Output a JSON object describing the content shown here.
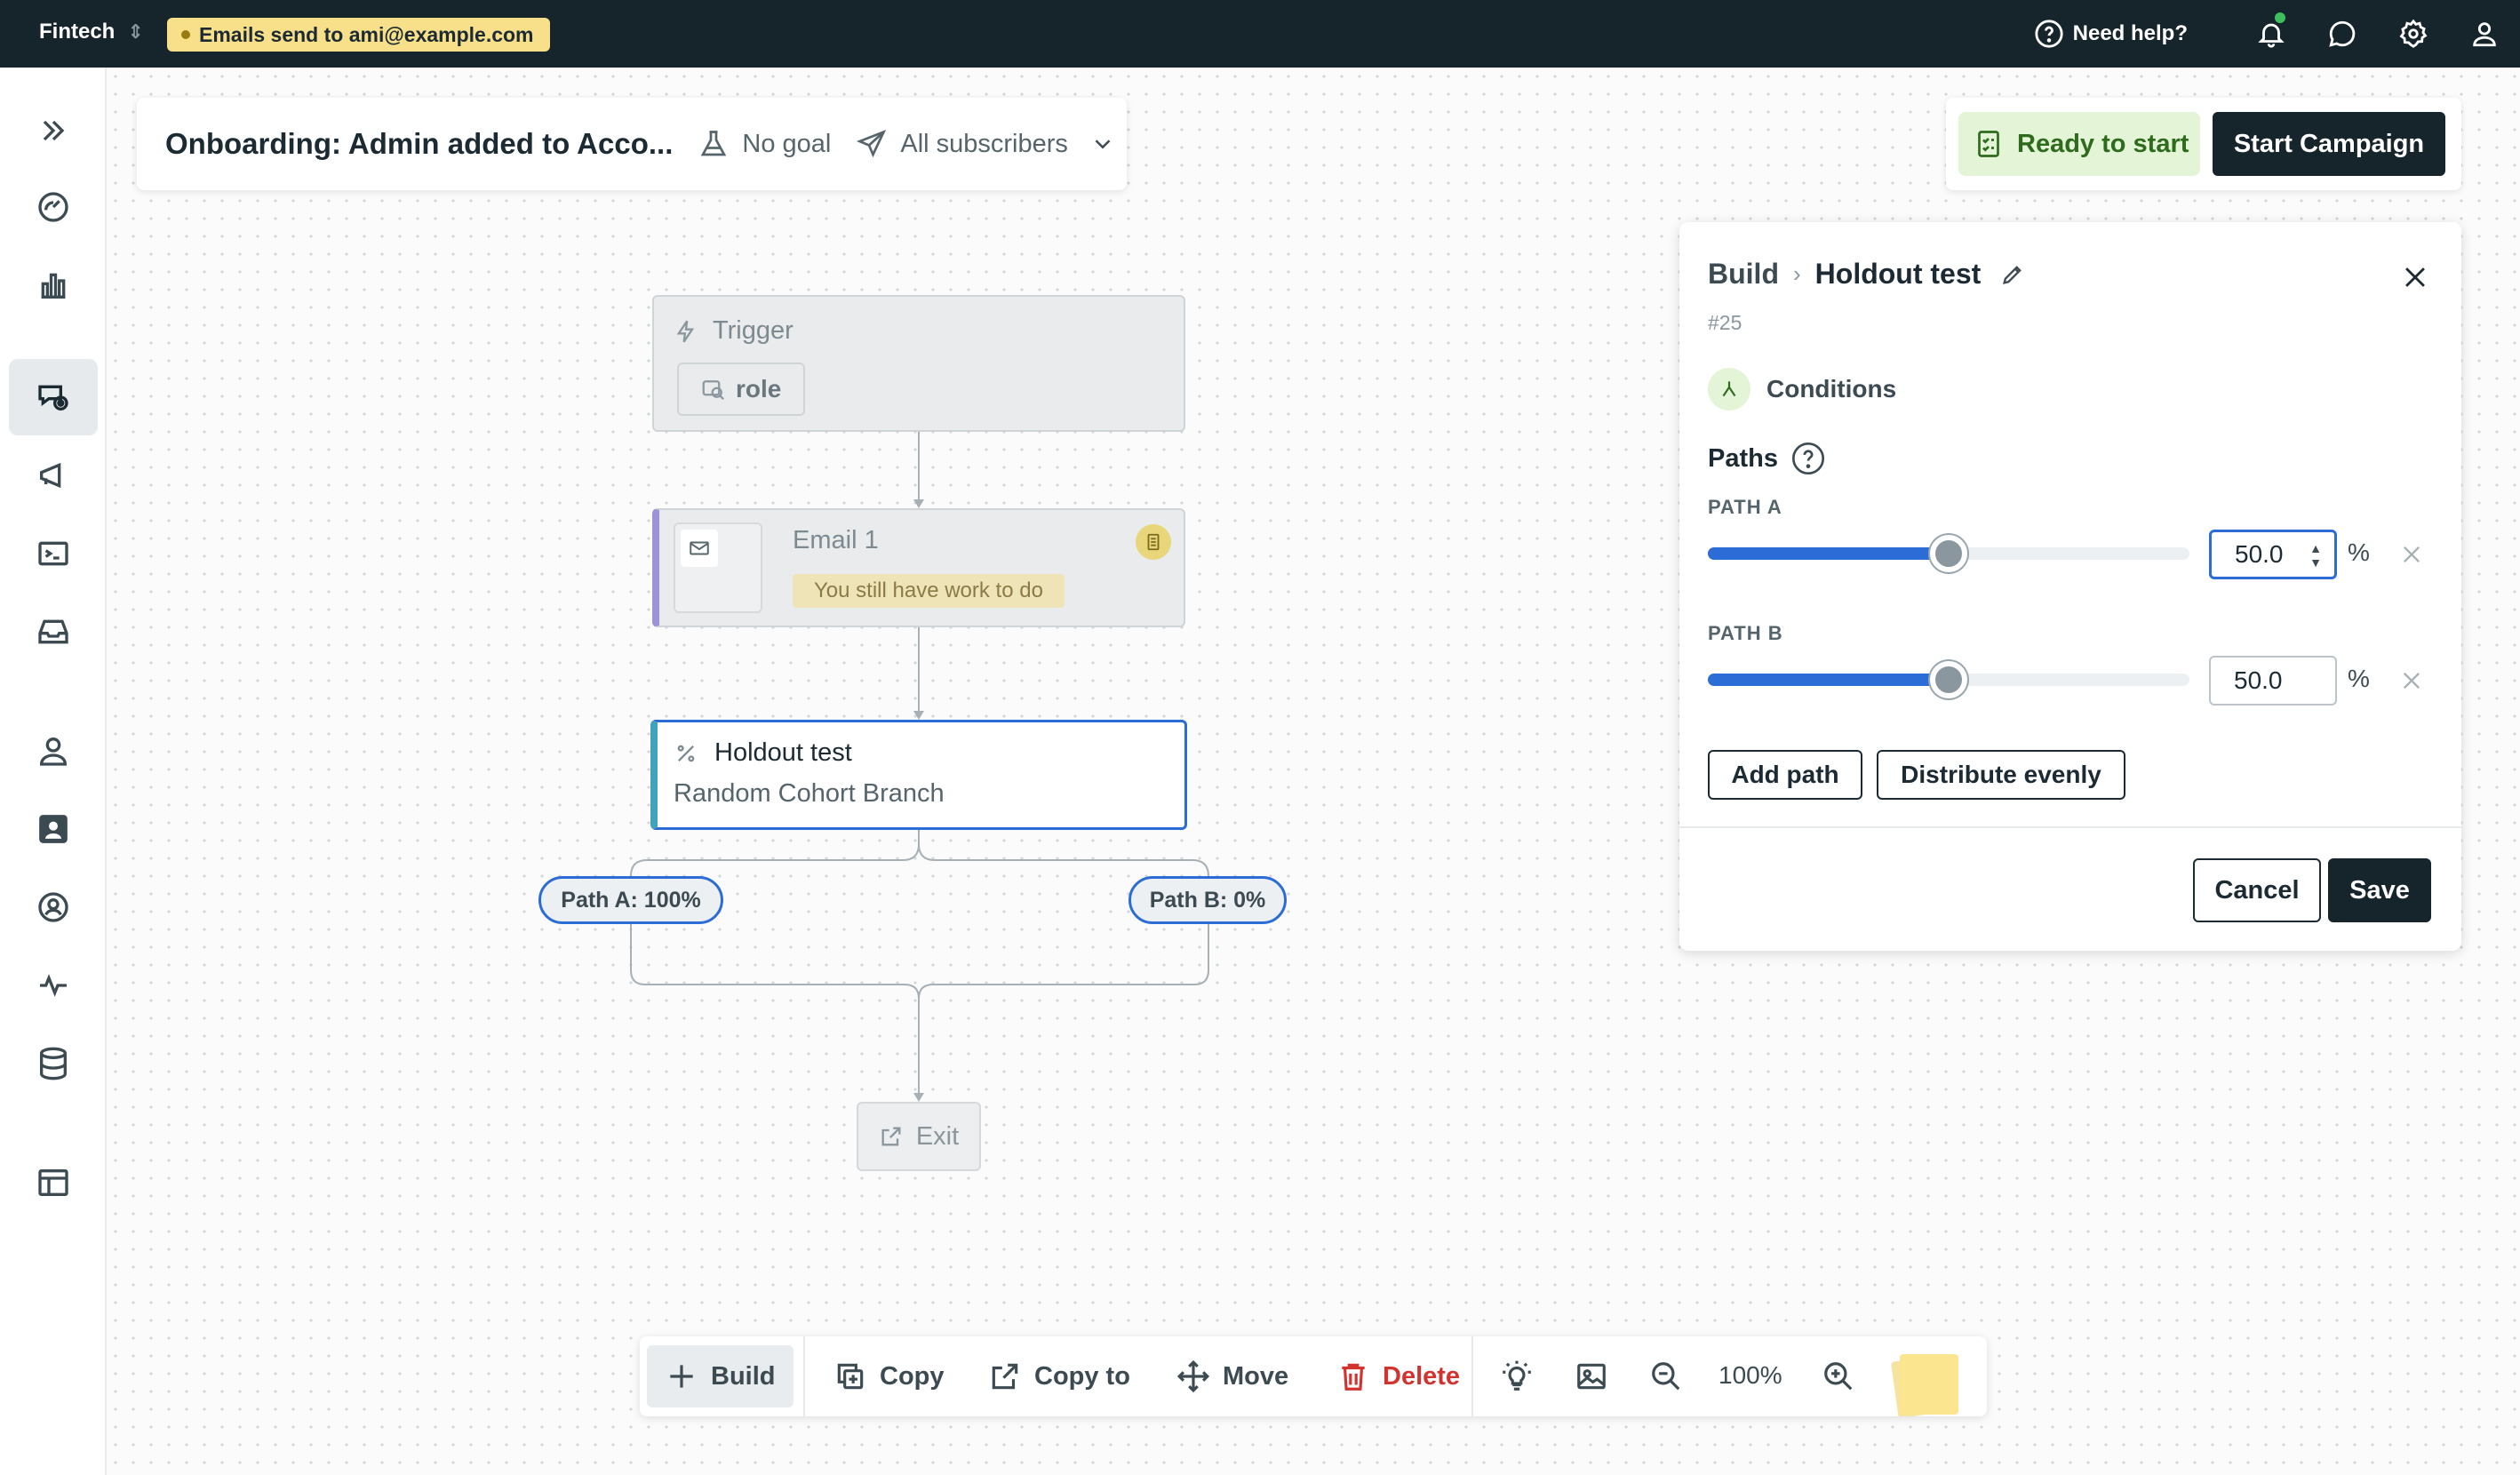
{
  "topbar": {
    "workspace": "Fintech",
    "env_notice": "Emails send to ami@example.com",
    "help_label": "Need help?"
  },
  "campaign": {
    "title": "Onboarding: Admin added to Acco...",
    "goal_label": "No goal",
    "audience_label": "All subscribers"
  },
  "status": {
    "ready_label": "Ready to start",
    "start_label": "Start Campaign"
  },
  "workflow": {
    "trigger": {
      "title": "Trigger",
      "chip": "role"
    },
    "email": {
      "title": "Email 1",
      "notice": "You still have work to do"
    },
    "holdout": {
      "title": "Holdout test",
      "subtitle": "Random Cohort Branch"
    },
    "path_a_label": "Path A: 100%",
    "path_b_label": "Path B: 0%",
    "exit_label": "Exit"
  },
  "panel": {
    "crumb_root": "Build",
    "crumb_current": "Holdout test",
    "node_id": "#25",
    "conditions_label": "Conditions",
    "paths_heading": "Paths",
    "paths": [
      {
        "label": "PATH A",
        "value": "50.0",
        "percent": 50,
        "unit": "%"
      },
      {
        "label": "PATH B",
        "value": "50.0",
        "percent": 50,
        "unit": "%"
      }
    ],
    "add_path_label": "Add path",
    "distribute_label": "Distribute evenly",
    "cancel_label": "Cancel",
    "save_label": "Save"
  },
  "toolbar": {
    "build_label": "Build",
    "copy_label": "Copy",
    "copy_to_label": "Copy to",
    "move_label": "Move",
    "delete_label": "Delete",
    "zoom_level": "100%"
  },
  "colors": {
    "topbar_bg": "#16242c",
    "accent_blue": "#2c6cd6",
    "ready_green_bg": "#e3f4d7",
    "delete_red": "#d2332f",
    "env_badge_bg": "#f7e089"
  },
  "icons": {
    "sidebar": [
      "expand-icon",
      "dashboard-icon",
      "analytics-icon",
      "campaigns-icon",
      "broadcasts-icon",
      "transactional-icon",
      "inbox-icon",
      "person-icon",
      "people-icon",
      "account-icon",
      "activity-icon",
      "data-icon",
      "table-icon"
    ],
    "topbar": [
      "help-icon",
      "bell-icon",
      "chat-icon",
      "gear-icon",
      "user-icon"
    ]
  }
}
